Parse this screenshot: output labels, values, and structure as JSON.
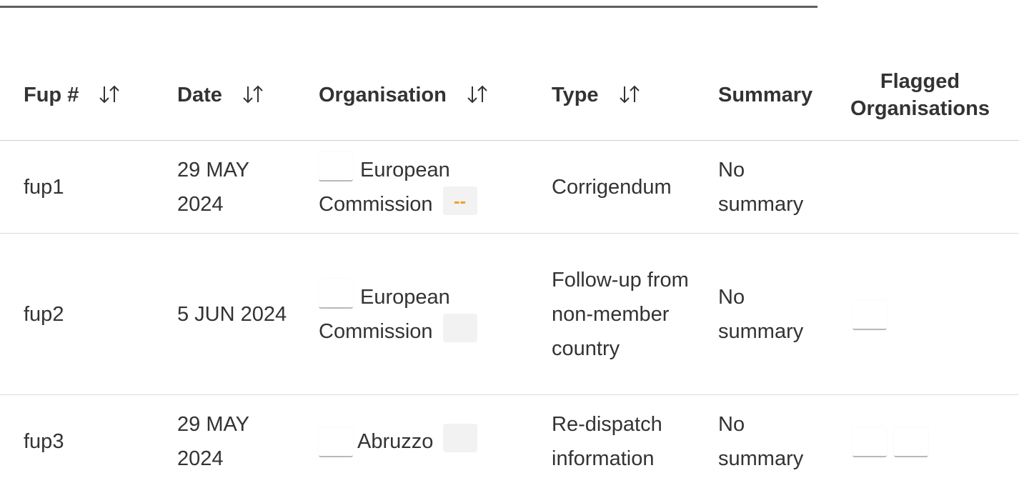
{
  "table": {
    "columns": [
      {
        "label": "Fup #",
        "sortable": true
      },
      {
        "label": "Date",
        "sortable": true
      },
      {
        "label": "Organisation",
        "sortable": true
      },
      {
        "label": "Type",
        "sortable": true
      },
      {
        "label": "Summary",
        "sortable": false
      },
      {
        "label": "Flagged Organisations",
        "sortable": false
      }
    ],
    "rows": [
      {
        "fup": "fup1",
        "date": "29 MAY 2024",
        "organisation": "European Commission",
        "badge": "--",
        "type": "Corrigendum",
        "summary": "No summary",
        "flagged_count": 0
      },
      {
        "fup": "fup2",
        "date": "5 JUN 2024",
        "organisation": "European Commission",
        "badge": "",
        "type": "Follow-up from non-member country",
        "summary": "No summary",
        "flagged_count": 1
      },
      {
        "fup": "fup3",
        "date": "29 MAY 2024",
        "organisation": "Abruzzo",
        "badge": "",
        "type": "Re-dispatch information",
        "summary": "No summary",
        "flagged_count": 2
      }
    ]
  },
  "icons": {
    "sort": "sort-arrows-icon",
    "flag": "flag-icon"
  },
  "colors": {
    "text": "#333333",
    "badge_text": "#f0a030",
    "badge_bg": "#f2f2f2",
    "top_rule": "#5f5f5f"
  }
}
